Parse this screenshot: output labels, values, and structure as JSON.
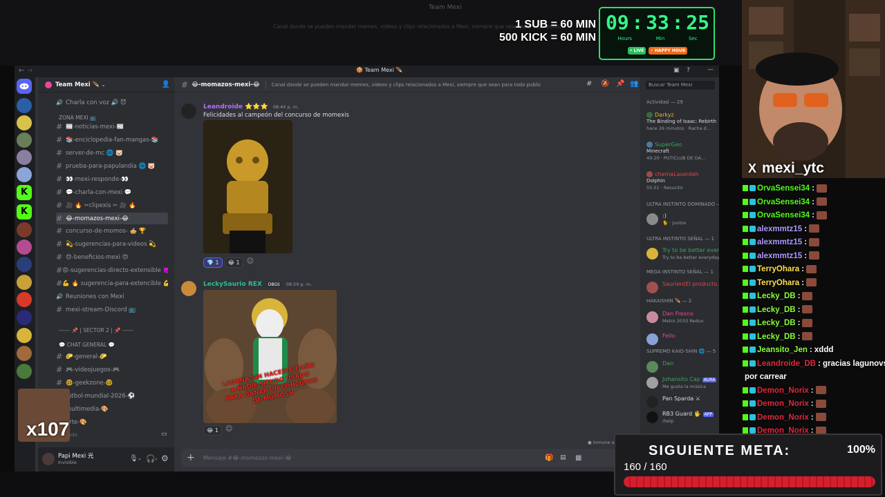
{
  "background": {
    "top_title": "Team Mexi",
    "bottom_line": "Canal donde se pueden mandar memes, videos y clips relacionados a Mexi, siempre que sean para todo publico."
  },
  "subathon": {
    "line1": "1 SUB = 60 MIN",
    "line2": "500 KICK = 60 MIN",
    "hours": "09",
    "minutes": "33",
    "seconds": "25",
    "hours_label": "Hours",
    "minutes_label": "Min",
    "seconds_label": "Sec",
    "btn_live": "• LIVE",
    "btn_happy": "⚡ HAPPY HOUR"
  },
  "discord": {
    "window_title": "Team Mexi",
    "server_name": "Team Mexi",
    "channels": [
      {
        "name": "Charla con voz 🔊 😈",
        "icon": "speaker-icon"
      },
      {
        "category": "ZONA MEXI 📺"
      },
      {
        "name": "📰-noticias-mexi-📰",
        "icon": "hash"
      },
      {
        "name": "📚-enciclopedia-fan-mangas-📚",
        "icon": "hash"
      },
      {
        "name": "server-de-mc 🌐 🐷",
        "icon": "hash"
      },
      {
        "name": "prueba-para-papulandia 🌐 🐷",
        "icon": "hash"
      },
      {
        "name": "👀-mexi-responde-👀",
        "icon": "hash"
      },
      {
        "name": "💬-charla-con-mexi 💬",
        "icon": "hash"
      },
      {
        "name": "🎥 🔥 ✂clipexis ✂ 🎥 🔥",
        "icon": "hash"
      },
      {
        "name": "😂-momazos-mexi-😂",
        "icon": "hash",
        "active": true
      },
      {
        "name": "concurso-de-momos- 🥧 🏆",
        "icon": "hash"
      },
      {
        "name": "💫-sugerencias-para-videos 💫",
        "icon": "hash"
      },
      {
        "name": "😍-beneficios-mexi 😍",
        "icon": "hash"
      },
      {
        "name": "😡-sugerencias-directo-extensible 👿",
        "icon": "hash"
      },
      {
        "name": "💪 🔥 sugerencia-para-extencible 💪 🔥",
        "icon": "hash"
      },
      {
        "name": "Reuniones con Mexi",
        "icon": "speaker"
      },
      {
        "name": "mexi-stream-Discord 📺",
        "icon": "hash"
      },
      {
        "category": "------ 📌 | SECTOR 2 | 📌 ------"
      },
      {
        "category": "💬 CHAT GENERAL 💬"
      },
      {
        "name": "🌮-general-🌮",
        "icon": "hash"
      },
      {
        "name": "🎮-videojuegos-🎮",
        "icon": "hash"
      },
      {
        "name": "🤓-geekzone-🤓",
        "icon": "hash"
      },
      {
        "name": "futbol-mundial-2026-⚽",
        "icon": "hash"
      },
      {
        "name": "multimedia-🎨",
        "icon": "hash"
      },
      {
        "name": "arte-🎨",
        "icon": "hash"
      }
    ],
    "voice_hint": "Voz conectada",
    "user": {
      "name": "Papi Mexi 光",
      "status": "Invisible"
    },
    "chat_header": {
      "channel": "😂-momazos-mexi-😂",
      "topic": "Canal donde se pueden mandar memes, videos y clips relacionados a Mexi, siempre que sean para todo publico."
    },
    "messages": [
      {
        "author": "Leandroide ⭐⭐⭐",
        "time": "08:44 p. m.",
        "text": "Felicidades al campeón del concurso de momexis",
        "reactions": [
          {
            "emoji": "💎",
            "count": "1"
          },
          {
            "emoji": "😂",
            "count": "1"
          }
        ]
      },
      {
        "author": "LeckySaurio REX",
        "tag": "DBGS",
        "time": "08:59 p. m.",
        "image_caption": "LAGUNA SIN HACERLE DAÑO A NADIE SIENDO USADO PARA GANAR UN CONCURSO DE MOMOSH",
        "reactions": [
          {
            "emoji": "😂",
            "count": "1"
          }
        ]
      }
    ],
    "input_placeholder": "Mensaje #😂-momazos-mexi-😂",
    "immune_note": "Inmune a",
    "members": {
      "search": "Buscar Team Mexi",
      "activity": "Actividad — 29",
      "items": [
        {
          "name": "Darkyz",
          "game": "The Binding of Isaac: Rebirth",
          "status": "hace 26 minutos · Racha d...",
          "color": "#f0b232"
        },
        {
          "name": "SuperGeo",
          "game": "Minecraft",
          "status": "49:20 · PUTICLUB DE DA...",
          "color": "#3ba55c"
        },
        {
          "name": "chemaLaserdeh",
          "game": "Dolphin",
          "status": "55:51 · Resucitó",
          "color": "#ed4245"
        },
        {
          "cat": "ULTRA INSTINTO DOMINADO — 1"
        },
        {
          "name": ":)",
          "status": "🐈 · Juntos",
          "color": "#dbdee1"
        },
        {
          "cat": "ULTRA INSTINTO SEÑAL — 1"
        },
        {
          "name": "Try to be better everyday.",
          "status": "Try to be better everyday. 🙌",
          "color": "#3ba55c"
        },
        {
          "cat": "MEGA INSTINTO SEÑAL — 1"
        },
        {
          "name": "Saurien(El producto...",
          "status": "",
          "color": "#ed4245"
        },
        {
          "cat": "HAKAISHIN 🪶 — 2"
        },
        {
          "name": "Dan Fresno",
          "status": "Metro 2033 Redux",
          "color": "#eb459e"
        },
        {
          "name": "Fello",
          "status": "",
          "color": "#eb459e"
        },
        {
          "cat": "SUPREMO KAIO-SHIN 🌐 — 5"
        },
        {
          "name": "Dan",
          "status": "",
          "color": "#3ba55c"
        },
        {
          "name": "Johansito Cap",
          "tag": "AURA",
          "status": "Me gusta la música",
          "color": "#3ba55c"
        },
        {
          "name": "Pan Sparda ⚔",
          "status": "",
          "color": "#dbdee1"
        },
        {
          "name": "RB3 Guard 🖐",
          "tag": "APP",
          "status": "/help",
          "color": "#dbdee1"
        }
      ]
    }
  },
  "webcam": {
    "handle": "mexi_ytc",
    "x_icon": "X"
  },
  "stream_chat": [
    {
      "user": "OrvaSensei34",
      "msg": ":",
      "color": "#53fc18",
      "emote": true
    },
    {
      "user": "OrvaSensei34",
      "msg": ":",
      "color": "#53fc18",
      "emote": true
    },
    {
      "user": "OrvaSensei34",
      "msg": ":",
      "color": "#53fc18",
      "emote": true
    },
    {
      "user": "alexmmtz15",
      "msg": ":",
      "color": "#b09aff",
      "emote": true
    },
    {
      "user": "alexmmtz15",
      "msg": ":",
      "color": "#b09aff",
      "emote": true
    },
    {
      "user": "alexmmtz15",
      "msg": ":",
      "color": "#b09aff",
      "emote": true
    },
    {
      "user": "TerryOhara",
      "msg": ":",
      "color": "#ffe14d",
      "emote": true
    },
    {
      "user": "TerryOhara",
      "msg": ":",
      "color": "#ffe14d",
      "emote": true
    },
    {
      "user": "Lecky_DB",
      "msg": ":",
      "color": "#8cff3a",
      "emote": true
    },
    {
      "user": "Lecky_DB",
      "msg": ":",
      "color": "#8cff3a",
      "emote": true
    },
    {
      "user": "Lecky_DB",
      "msg": ":",
      "color": "#8cff3a",
      "emote": true
    },
    {
      "user": "Lecky_DB",
      "msg": ":",
      "color": "#8cff3a",
      "emote": true
    },
    {
      "user": "Jeansito_Jen",
      "msg": ": xddd",
      "color": "#8cff3a",
      "emote": false
    },
    {
      "user": "Leandroide_DB",
      "msg": ": gracias lagunovski",
      "color": "#e0293b",
      "emote": false
    },
    {
      "user": "",
      "msg": "por carrear",
      "color": "#ffffff",
      "emote": false
    },
    {
      "user": "Demon_Norix",
      "msg": ":",
      "color": "#e0293b",
      "emote": true
    },
    {
      "user": "Demon_Norix",
      "msg": ":",
      "color": "#e0293b",
      "emote": true
    },
    {
      "user": "Demon_Norix",
      "msg": ":",
      "color": "#e0293b",
      "emote": true
    },
    {
      "user": "Demon_Norix",
      "msg": ":",
      "color": "#e0293b",
      "emote": true
    }
  ],
  "goal": {
    "title": "SIGUIENTE META:",
    "percent": "100%",
    "count": "160 / 160",
    "progress": 1.0
  },
  "overlay_badge": "x107"
}
